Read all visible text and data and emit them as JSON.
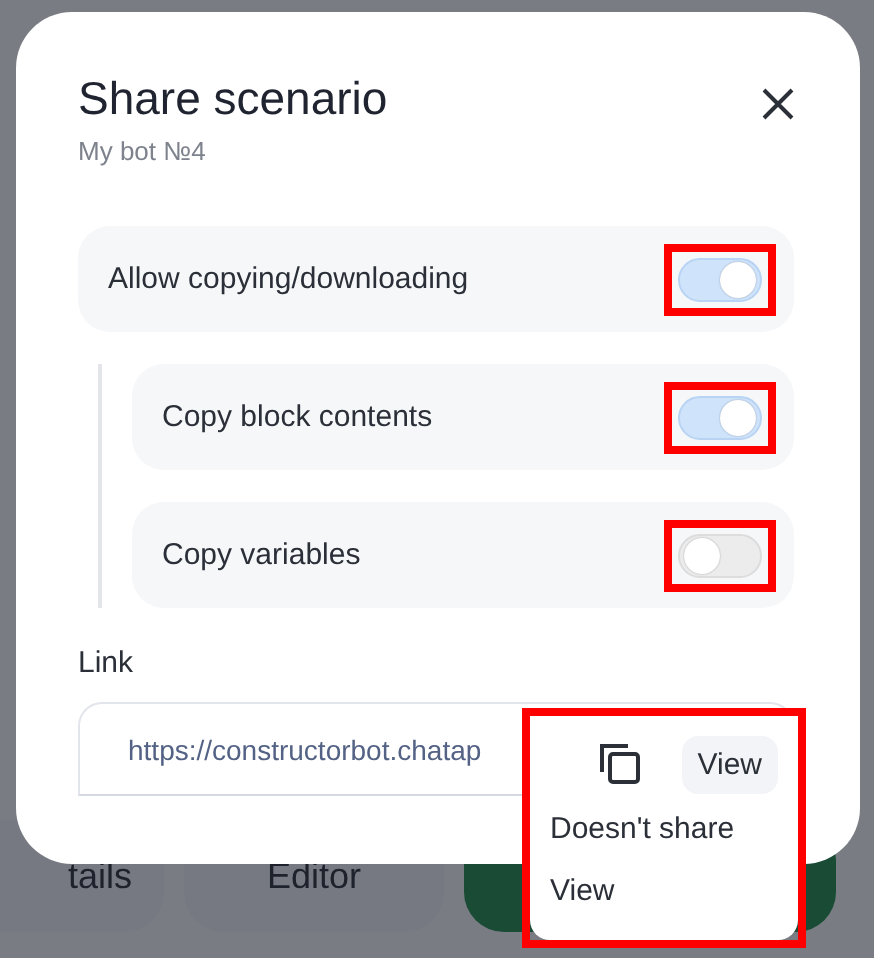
{
  "background": {
    "buttons": [
      {
        "label": "tails",
        "kind": "secondary"
      },
      {
        "label": "Editor",
        "kind": "secondary"
      },
      {
        "kind": "primary"
      }
    ]
  },
  "dialog": {
    "title": "Share scenario",
    "subtitle": "My bot №4",
    "options": [
      {
        "label": "Allow copying/downloading",
        "on": true,
        "annotated": true,
        "children": [
          {
            "label": "Copy block contents",
            "on": true,
            "annotated": true
          },
          {
            "label": "Copy variables",
            "on": false,
            "annotated": true
          }
        ]
      }
    ],
    "link": {
      "label": "Link",
      "value": "https://constructorbot.chatap",
      "access": "View",
      "annotated": true,
      "menu": [
        {
          "label": "Doesn't share"
        },
        {
          "label": "View"
        }
      ]
    }
  }
}
